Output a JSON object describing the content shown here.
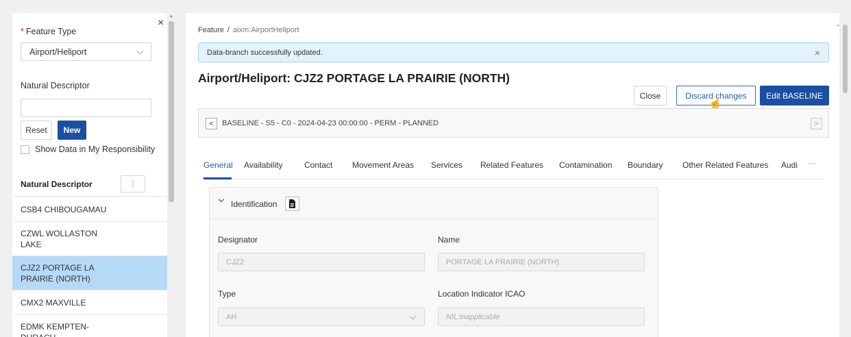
{
  "sidebar": {
    "feature_type_label": "Feature Type",
    "required_mark": "*",
    "feature_type_value": "Airport/Heliport",
    "natural_descriptor_label": "Natural Descriptor",
    "natural_descriptor_value": "",
    "reset_label": "Reset",
    "new_label": "New",
    "show_data_label": "Show Data in My Responsibility",
    "list_header": "Natural Descriptor",
    "kebab": "⋮",
    "close": "×",
    "items": [
      {
        "label": "CSB4 CHIBOUGAMAU",
        "active": false
      },
      {
        "label": "CZWL WOLLASTON LAKE",
        "active": false
      },
      {
        "label": "CJZ2 PORTAGE LA PRAIRIE (NORTH)",
        "active": true
      },
      {
        "label": "CMX2 MAXVILLE",
        "active": false
      },
      {
        "label": "EDMK KEMPTEN-DURACH",
        "active": false
      }
    ]
  },
  "breadcrumb": {
    "root": "Feature",
    "separator": "/",
    "current": "aixm:AirportHeliport"
  },
  "alert": {
    "message": "Data-branch successfully updated.",
    "close": "×"
  },
  "page_title": "Airport/Heliport: CJZ2 PORTAGE LA PRAIRIE (NORTH)",
  "actions": {
    "close": "Close",
    "discard": "Discard changes",
    "edit": "Edit BASELINE"
  },
  "version_bar": {
    "text": "BASELINE - S5 - C0 - 2024-04-23 00:00:00 - PERM - PLANNED",
    "prev": "<",
    "next": ">"
  },
  "tabs": [
    {
      "label": "General",
      "active": true
    },
    {
      "label": "Availability"
    },
    {
      "label": "Contact"
    },
    {
      "label": "Movement Areas"
    },
    {
      "label": "Services"
    },
    {
      "label": "Related Features"
    },
    {
      "label": "Contamination"
    },
    {
      "label": "Boundary"
    },
    {
      "label": "Other Related Features"
    },
    {
      "label": "Audi"
    }
  ],
  "tabs_more": "···",
  "identification": {
    "title": "Identification",
    "designator_label": "Designator",
    "designator_value": "CJZ2",
    "name_label": "Name",
    "name_value": "PORTAGE LA PRAIRIE (NORTH)",
    "type_label": "Type",
    "type_value": "AH",
    "icao_label": "Location Indicator ICAO",
    "icao_value": "NIL:inapplicable"
  },
  "icons": [
    "close-icon",
    "chevron-down-icon",
    "kebab-menu-icon",
    "chevron-left-icon",
    "chevron-right-icon",
    "caret-down-icon",
    "document-icon",
    "hand-cursor-icon",
    "expand-icon"
  ]
}
